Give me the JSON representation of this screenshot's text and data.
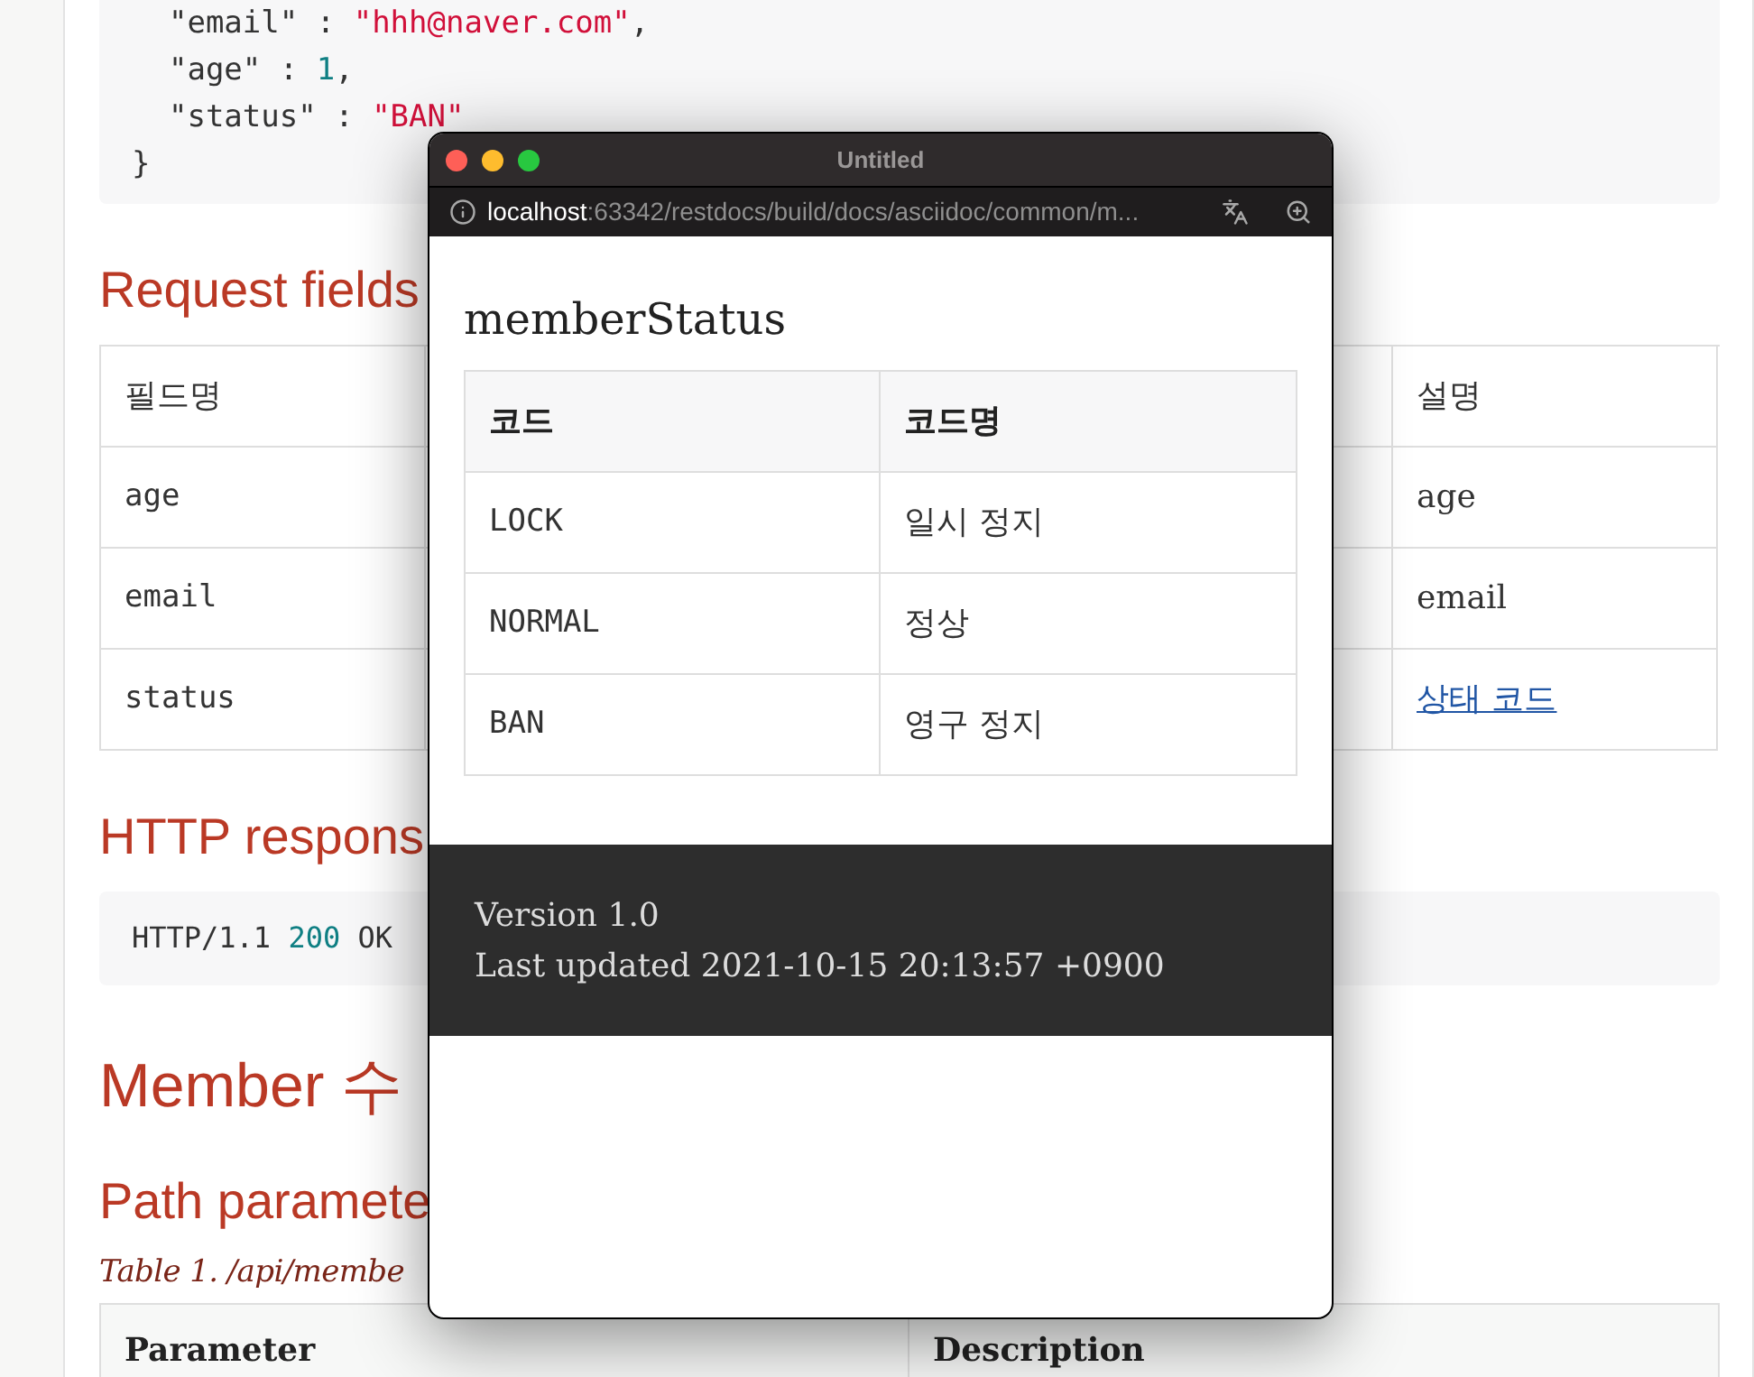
{
  "document": {
    "code_block": {
      "lines": [
        [
          {
            "kind": "plain",
            "text": "  \"email\" : "
          },
          {
            "kind": "string",
            "text": "\"hhh@naver.com\""
          },
          {
            "kind": "plain",
            "text": ","
          }
        ],
        [
          {
            "kind": "plain",
            "text": "  \"age\" : "
          },
          {
            "kind": "number",
            "text": "1"
          },
          {
            "kind": "plain",
            "text": ","
          }
        ],
        [
          {
            "kind": "plain",
            "text": "  \"status\" : "
          },
          {
            "kind": "string",
            "text": "\"BAN\""
          }
        ],
        [
          {
            "kind": "plain",
            "text": "}"
          }
        ]
      ]
    },
    "request_fields": {
      "heading": "Request fields",
      "columns": [
        "필드명",
        "설명"
      ],
      "rows": [
        {
          "field": "age",
          "description": "age",
          "kind": "text"
        },
        {
          "field": "email",
          "description": "email",
          "kind": "text"
        },
        {
          "field": "status",
          "description": "상태 코드",
          "kind": "link"
        }
      ]
    },
    "http_response": {
      "heading": "HTTP respons",
      "lines": [
        [
          {
            "kind": "plain",
            "text": "HTTP/1.1 "
          },
          {
            "kind": "number",
            "text": "200"
          },
          {
            "kind": "plain",
            "text": " OK"
          }
        ]
      ]
    },
    "section_heading": "Member 수",
    "path_parameters": {
      "heading": "Path paramete",
      "caption": "Table 1. /api/membe",
      "columns": [
        "Parameter",
        "Description"
      ]
    }
  },
  "popup_window": {
    "title": "Untitled",
    "address": {
      "host": "localhost",
      "path": ":63342/restdocs/build/docs/asciidoc/common/m..."
    },
    "heading": "memberStatus",
    "table": {
      "columns": [
        "코드",
        "코드명"
      ],
      "rows": [
        [
          "LOCK",
          "일시 정지"
        ],
        [
          "NORMAL",
          "정상"
        ],
        [
          "BAN",
          "영구 정지"
        ]
      ]
    },
    "footer": [
      "Version 1.0",
      "Last updated 2021-10-15 20:13:57 +0900"
    ]
  }
}
